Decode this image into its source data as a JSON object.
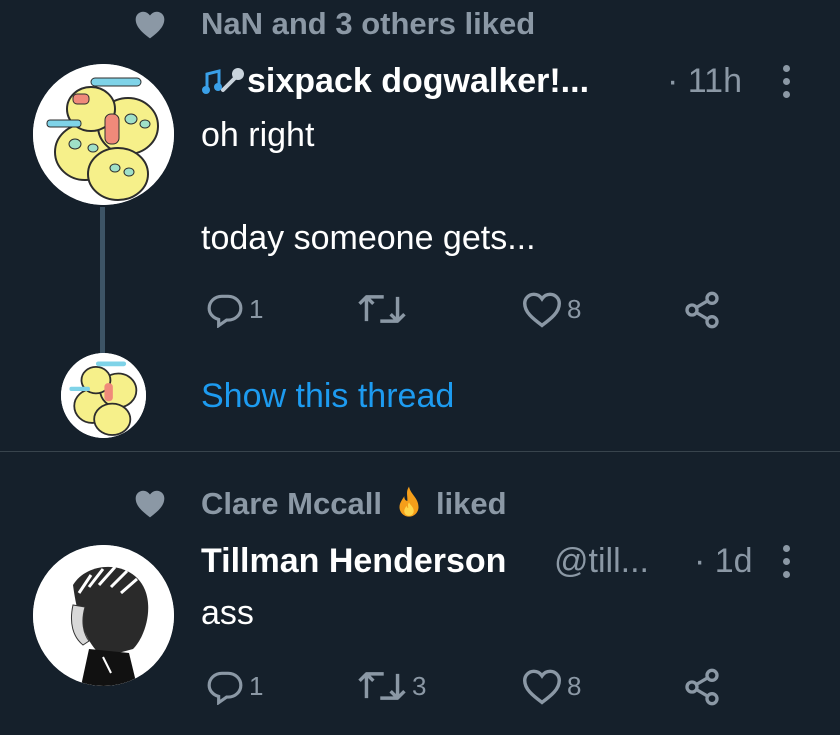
{
  "tweet1": {
    "social_context": "NaN and 3 others liked",
    "display_name": "sixpack dogwalker!...",
    "time": "· 11h",
    "text_line1": "oh right",
    "text_line2": "today someone gets...",
    "reply_count": "1",
    "retweet_count": "",
    "like_count": "8",
    "show_thread": "Show this thread"
  },
  "tweet2": {
    "social_context_name": "Clare Mccall",
    "social_context_suffix": "liked",
    "display_name": "Tillman Henderson",
    "handle": "@till...",
    "time": "· 1d",
    "text": "ass",
    "reply_count": "1",
    "retweet_count": "3",
    "like_count": "8"
  },
  "icons": {
    "social_heart": "heart-filled-icon",
    "music": "musical-note-microphone-icon",
    "fire": "fire-emoji-icon",
    "reply": "reply-bubble-icon",
    "retweet": "retweet-icon",
    "like": "heart-outline-icon",
    "share": "share-icon",
    "more": "more-options-icon"
  },
  "colors": {
    "background": "#15202b",
    "secondary_text": "#8b98a5",
    "link": "#1d9bf0",
    "divider": "#38444d"
  }
}
